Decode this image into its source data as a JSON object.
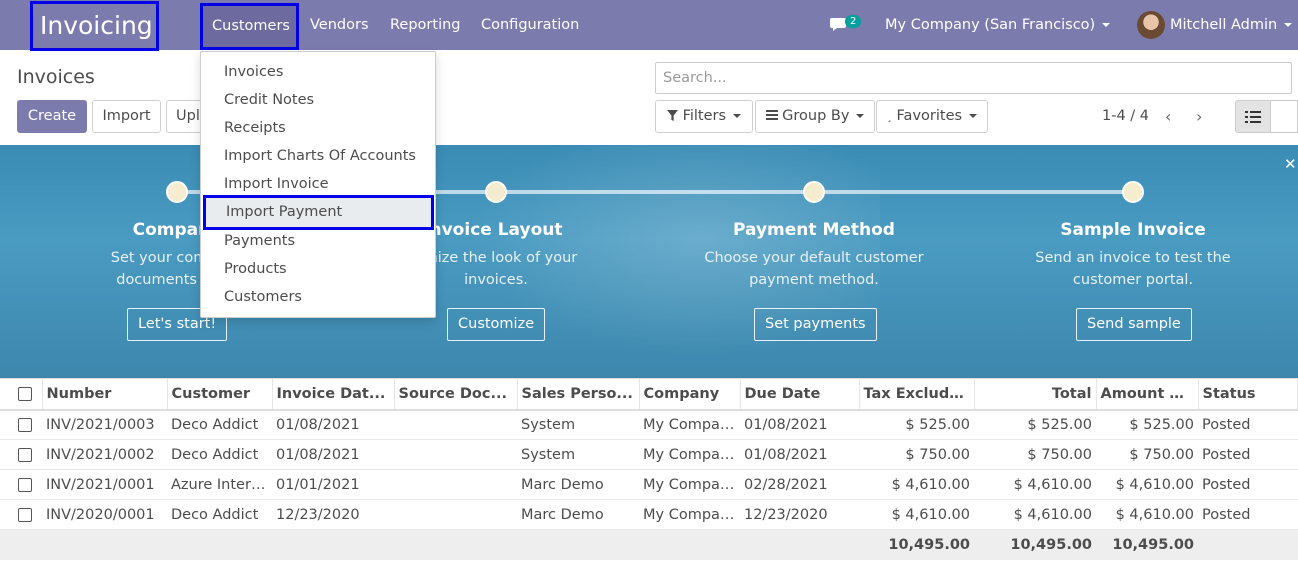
{
  "topbar": {
    "app_title": "Invoicing",
    "menu": [
      "Customers",
      "Vendors",
      "Reporting",
      "Configuration"
    ],
    "chat_count": "2",
    "company": "My Company (San Francisco)",
    "user": "Mitchell Admin"
  },
  "control": {
    "page_title": "Invoices",
    "create_label": "Create",
    "import_label": "Import",
    "upload_label": "Upl",
    "search_placeholder": "Search...",
    "filters_label": "Filters",
    "groupby_label": "Group By",
    "favorites_label": "Favorites",
    "pager": "1-4 / 4"
  },
  "dropdown": {
    "items": [
      "Invoices",
      "Credit Notes",
      "Receipts",
      "Import Charts Of Accounts",
      "Import Invoice",
      "Import Payment",
      "Payments",
      "Products",
      "Customers"
    ],
    "highlighted": "Import Payment"
  },
  "onboarding": {
    "steps": [
      {
        "title": "Company",
        "desc1": "Set your company",
        "desc2": "documents head",
        "button": "Let's start!"
      },
      {
        "title": "nvoice Layout",
        "desc1": "omize the look of your",
        "desc2": "invoices.",
        "button": "Customize"
      },
      {
        "title": "Payment Method",
        "desc1": "Choose your default customer",
        "desc2": "payment method.",
        "button": "Set payments"
      },
      {
        "title": "Sample Invoice",
        "desc1": "Send an invoice to test the",
        "desc2": "customer portal.",
        "button": "Send sample"
      }
    ]
  },
  "table": {
    "headers": [
      "Number",
      "Customer",
      "Invoice Dat...",
      "Source Doc...",
      "Sales Perso...",
      "Company",
      "Due Date",
      "Tax Exclude...",
      "Total",
      "Amount Du...",
      "Status"
    ],
    "rows": [
      [
        "INV/2021/0003",
        "Deco Addict",
        "01/08/2021",
        "",
        "System",
        "My Company ...",
        "01/08/2021",
        "$ 525.00",
        "$ 525.00",
        "$ 525.00",
        "Posted"
      ],
      [
        "INV/2021/0002",
        "Deco Addict",
        "01/08/2021",
        "",
        "System",
        "My Company ...",
        "01/08/2021",
        "$ 750.00",
        "$ 750.00",
        "$ 750.00",
        "Posted"
      ],
      [
        "INV/2021/0001",
        "Azure Interior",
        "01/01/2021",
        "",
        "Marc Demo",
        "My Company ...",
        "02/28/2021",
        "$ 4,610.00",
        "$ 4,610.00",
        "$ 4,610.00",
        "Posted"
      ],
      [
        "INV/2020/0001",
        "Deco Addict",
        "12/23/2020",
        "",
        "Marc Demo",
        "My Company ...",
        "12/23/2020",
        "$ 4,610.00",
        "$ 4,610.00",
        "$ 4,610.00",
        "Posted"
      ]
    ],
    "totals": {
      "tax_excluded": "10,495.00",
      "total": "10,495.00",
      "amount_due": "10,495.00"
    }
  }
}
